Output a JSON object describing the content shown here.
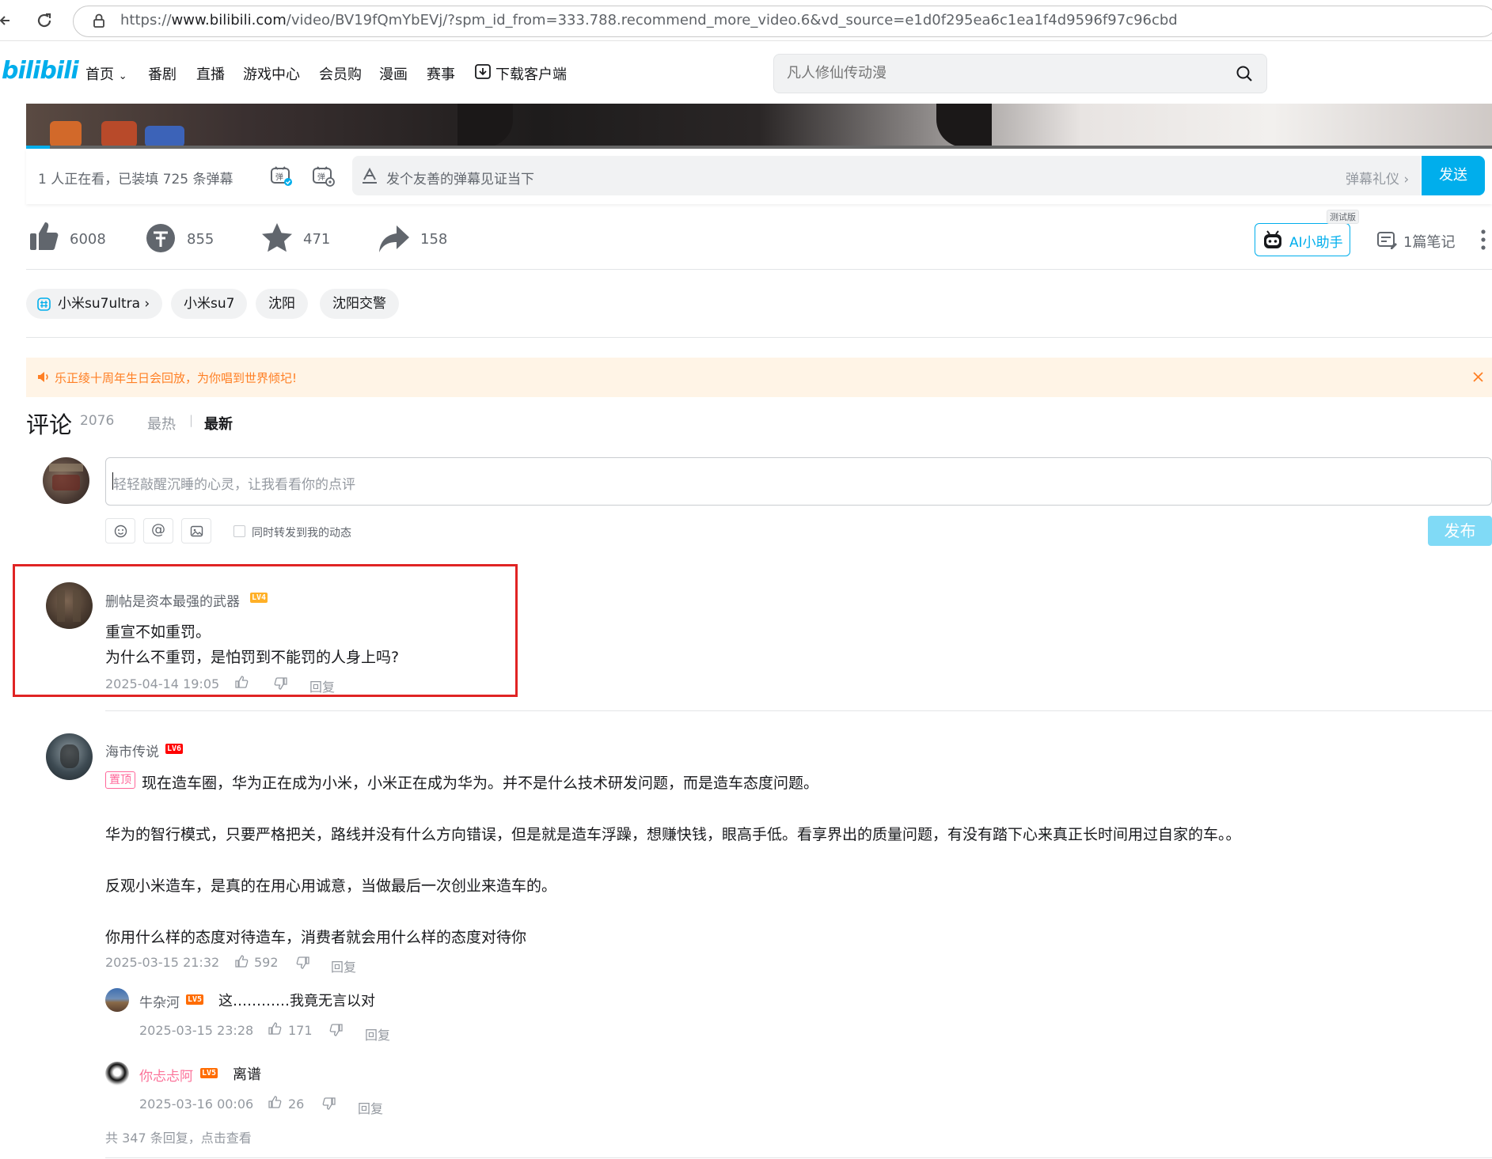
{
  "browser": {
    "url_prefix": "https://",
    "url_domain": "www.bilibili.com",
    "url_rest": "/video/BV19fQmYbEVj/?spm_id_from=333.788.recommend_more_video.6&vd_source=e1d0f295ea6c1ea1f4d9596f97c96cbd"
  },
  "header": {
    "logo": "bilibili",
    "nav": [
      "首页",
      "番剧",
      "直播",
      "游戏中心",
      "会员购",
      "漫画",
      "赛事",
      "下载客户端"
    ],
    "search_placeholder": "凡人修仙传动漫"
  },
  "danmaku": {
    "viewer_text": "1 人正在看，已装填 725 条弹幕",
    "input_placeholder": "发个友善的弹幕见证当下",
    "etiquette": "弹幕礼仪 ›",
    "send": "发送"
  },
  "actions": {
    "like": "6008",
    "coin": "855",
    "favorite": "471",
    "share": "158",
    "ai_beta": "测试版",
    "ai_label": "AI小助手",
    "notes": "1篇笔记"
  },
  "tags": [
    "小米su7ultra ›",
    "小米su7",
    "沈阳",
    "沈阳交警"
  ],
  "notice": {
    "text": "乐正绫十周年生日会回放，为你唱到世界倾圮!"
  },
  "comments_header": {
    "title": "评论",
    "count": "2076",
    "sort_hot": "最热",
    "sort_sep": "|",
    "sort_new": "最新"
  },
  "comment_box": {
    "placeholder": "轻轻敲醒沉睡的心灵，让我看看你的点评",
    "forward_label": "同时转发到我的动态",
    "publish": "发布"
  },
  "comments": [
    {
      "user": "删帖是资本最强的武器",
      "level": "LV4",
      "lines": [
        "重宣不如重罚。",
        "为什么不重罚，是怕罚到不能罚的人身上吗?"
      ],
      "time": "2025-04-14 19:05",
      "likes": "",
      "reply": "回复"
    },
    {
      "user": "海市传说",
      "level": "LV6",
      "pin": "置顶",
      "lines": [
        "现在造车圈，华为正在成为小米，小米正在成为华为。并不是什么技术研发问题，而是造车态度问题。",
        "华为的智行模式，只要严格把关，路线并没有什么方向错误，但是就是造车浮躁，想赚快钱，眼高手低。看享界出的质量问题，有没有踏下心来真正长时间用过自家的车。。",
        "反观小米造车，是真的在用心用诚意，当做最后一次创业来造车的。",
        "你用什么样的态度对待造车，消费者就会用什么样的态度对待你"
      ],
      "time": "2025-03-15 21:32",
      "likes": "592",
      "reply": "回复",
      "replies": [
        {
          "user": "牛杂河",
          "level": "LV5",
          "text": "这…………我竟无言以对",
          "time": "2025-03-15 23:28",
          "likes": "171",
          "reply": "回复"
        },
        {
          "user": "你忐忐阿",
          "level": "LV5",
          "text": "离谱",
          "time": "2025-03-16 00:06",
          "likes": "26",
          "reply": "回复"
        }
      ],
      "more_replies": "共 347 条回复，点击查看"
    }
  ],
  "colors": {
    "brand": "#00aeec",
    "pink": "#fb7299",
    "lv4": "#ffb027",
    "lv5": "#ff6c00",
    "lv6": "#ff0000",
    "highlight": "#e02424"
  }
}
